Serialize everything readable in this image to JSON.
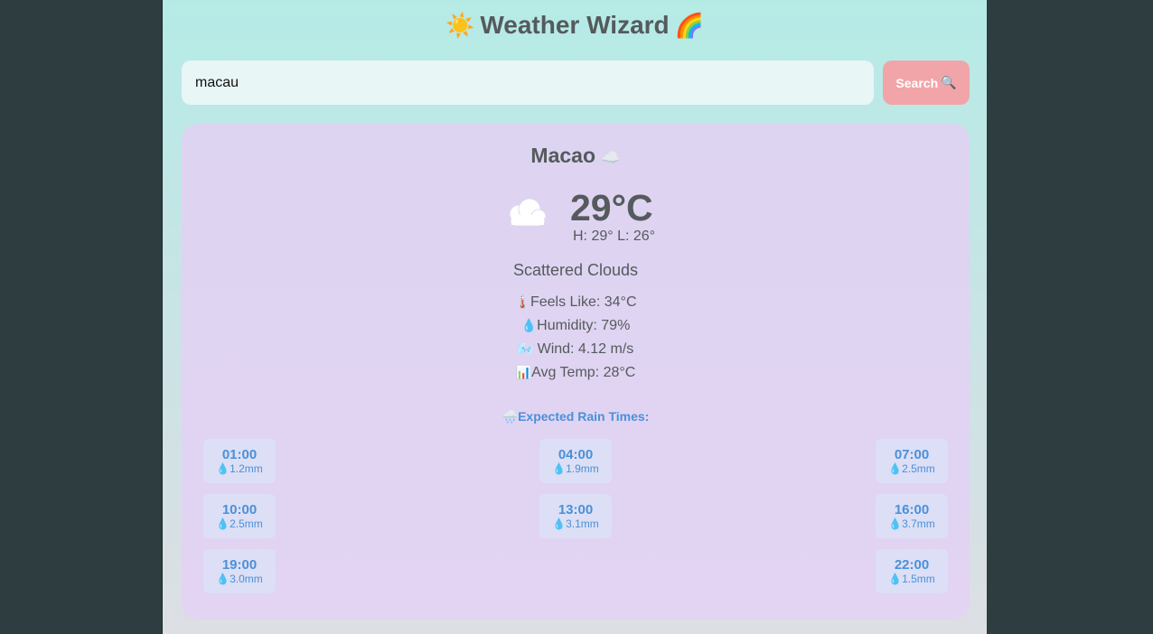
{
  "header": {
    "title": "Weather Wizard",
    "left_emoji": "☀️",
    "right_emoji": "🌈"
  },
  "search": {
    "value": "macau",
    "button_label": "Search",
    "button_icon": "🔍"
  },
  "weather": {
    "city": "Macao",
    "city_emoji": "☁️",
    "icon": "cloud-icon",
    "temperature": "29°C",
    "hilo": "H: 29° L: 26°",
    "description": "Scattered Clouds",
    "details": [
      {
        "emoji": "🌡️",
        "text": "Feels Like: 34°C"
      },
      {
        "emoji": "💧",
        "text": "Humidity: 79%"
      },
      {
        "emoji": "🌬️",
        "text": " Wind: 4.12 m/s"
      },
      {
        "emoji": "📊",
        "text": "Avg Temp: 28°C"
      }
    ]
  },
  "rain": {
    "title": "Expected Rain Times:",
    "title_emoji": "🌧️",
    "drop_emoji": "💧",
    "slots": [
      {
        "time": "01:00",
        "amount": "1.2mm"
      },
      {
        "time": "04:00",
        "amount": "1.9mm"
      },
      {
        "time": "07:00",
        "amount": "2.5mm"
      },
      {
        "time": "10:00",
        "amount": "2.5mm"
      },
      {
        "time": "13:00",
        "amount": "3.1mm"
      },
      {
        "time": "16:00",
        "amount": "3.7mm"
      },
      {
        "time": "19:00",
        "amount": "3.0mm"
      },
      {
        "time": "22:00",
        "amount": "1.5mm"
      }
    ]
  },
  "colors": {
    "accent_blue": "#4a90d9",
    "search_button": "#f1a5a8",
    "text": "#555a5c"
  }
}
